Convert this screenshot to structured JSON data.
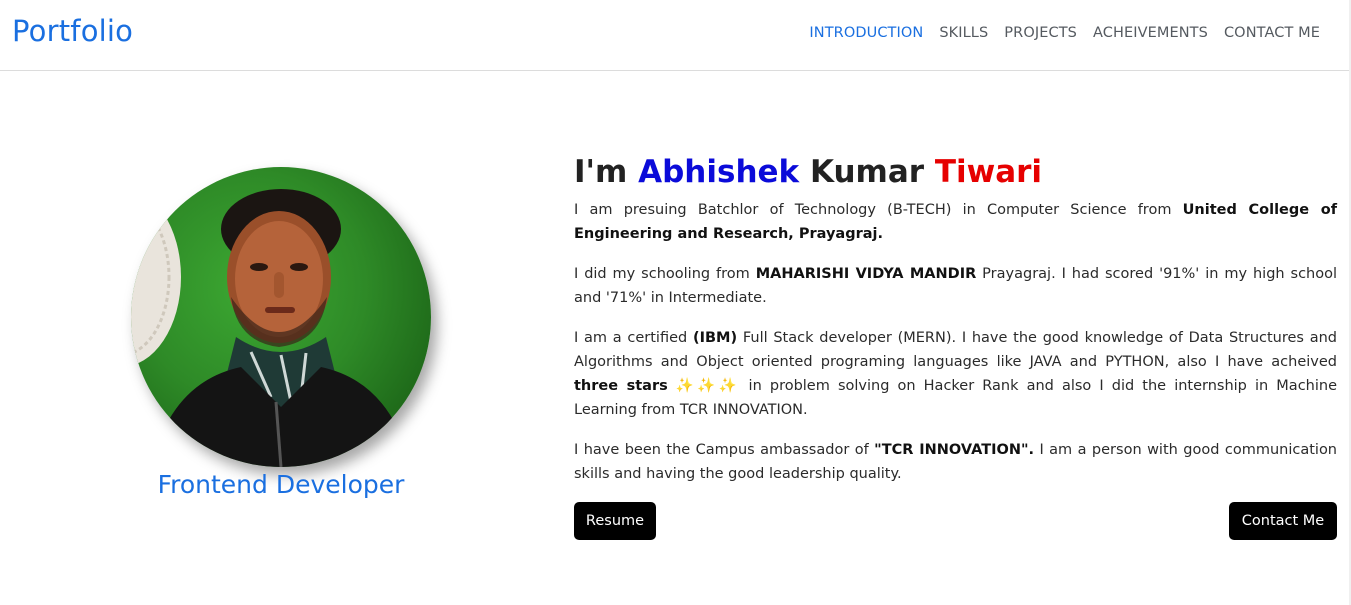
{
  "navbar": {
    "brand": "Portfolio",
    "links": [
      {
        "label": "INTRODUCTION",
        "active": true
      },
      {
        "label": "SKILLS",
        "active": false
      },
      {
        "label": "PROJECTS",
        "active": false
      },
      {
        "label": "ACHEIVEMENTS",
        "active": false
      },
      {
        "label": "CONTACT ME",
        "active": false
      }
    ]
  },
  "profile": {
    "role": "Frontend Developer"
  },
  "intro": {
    "heading": {
      "prefix": "I'm ",
      "first": "Abhishek",
      "middle": " Kumar ",
      "last": "Tiwari"
    },
    "p1": {
      "text": "I am presuing Batchlor of Technology (B-TECH) in Computer Science from ",
      "bold": "United College of Engineering and Research, Prayagraj."
    },
    "p2": {
      "text1": "I did my schooling from ",
      "bold": "MAHARISHI VIDYA MANDIR",
      "text2": " Prayagraj. I had scored '91%' in my high school and '71%' in Intermediate."
    },
    "p3": {
      "text1": "I am a certified ",
      "bold1": "(IBM)",
      "text2": " Full Stack developer (MERN). I have the good knowledge of Data Structures and Algorithms and Object oriented programing languages like JAVA and PYTHON, also I have acheived ",
      "bold2": "three stars",
      "stars": " ✨✨✨ ",
      "text3": "in problem solving on Hacker Rank and also I did the internship in Machine Learning from TCR INNOVATION."
    },
    "p4": {
      "text1": "I have been the Campus ambassador of ",
      "bold": "\"TCR INNOVATION\".",
      "text2": " I am a person with good communication skills and having the good leadership quality."
    }
  },
  "buttons": {
    "resume": "Resume",
    "contact": "Contact Me"
  },
  "colors": {
    "accent": "#1a6fe0",
    "name_blue": "#0b0bd9",
    "name_red": "#e60000",
    "button_bg": "#000000"
  }
}
